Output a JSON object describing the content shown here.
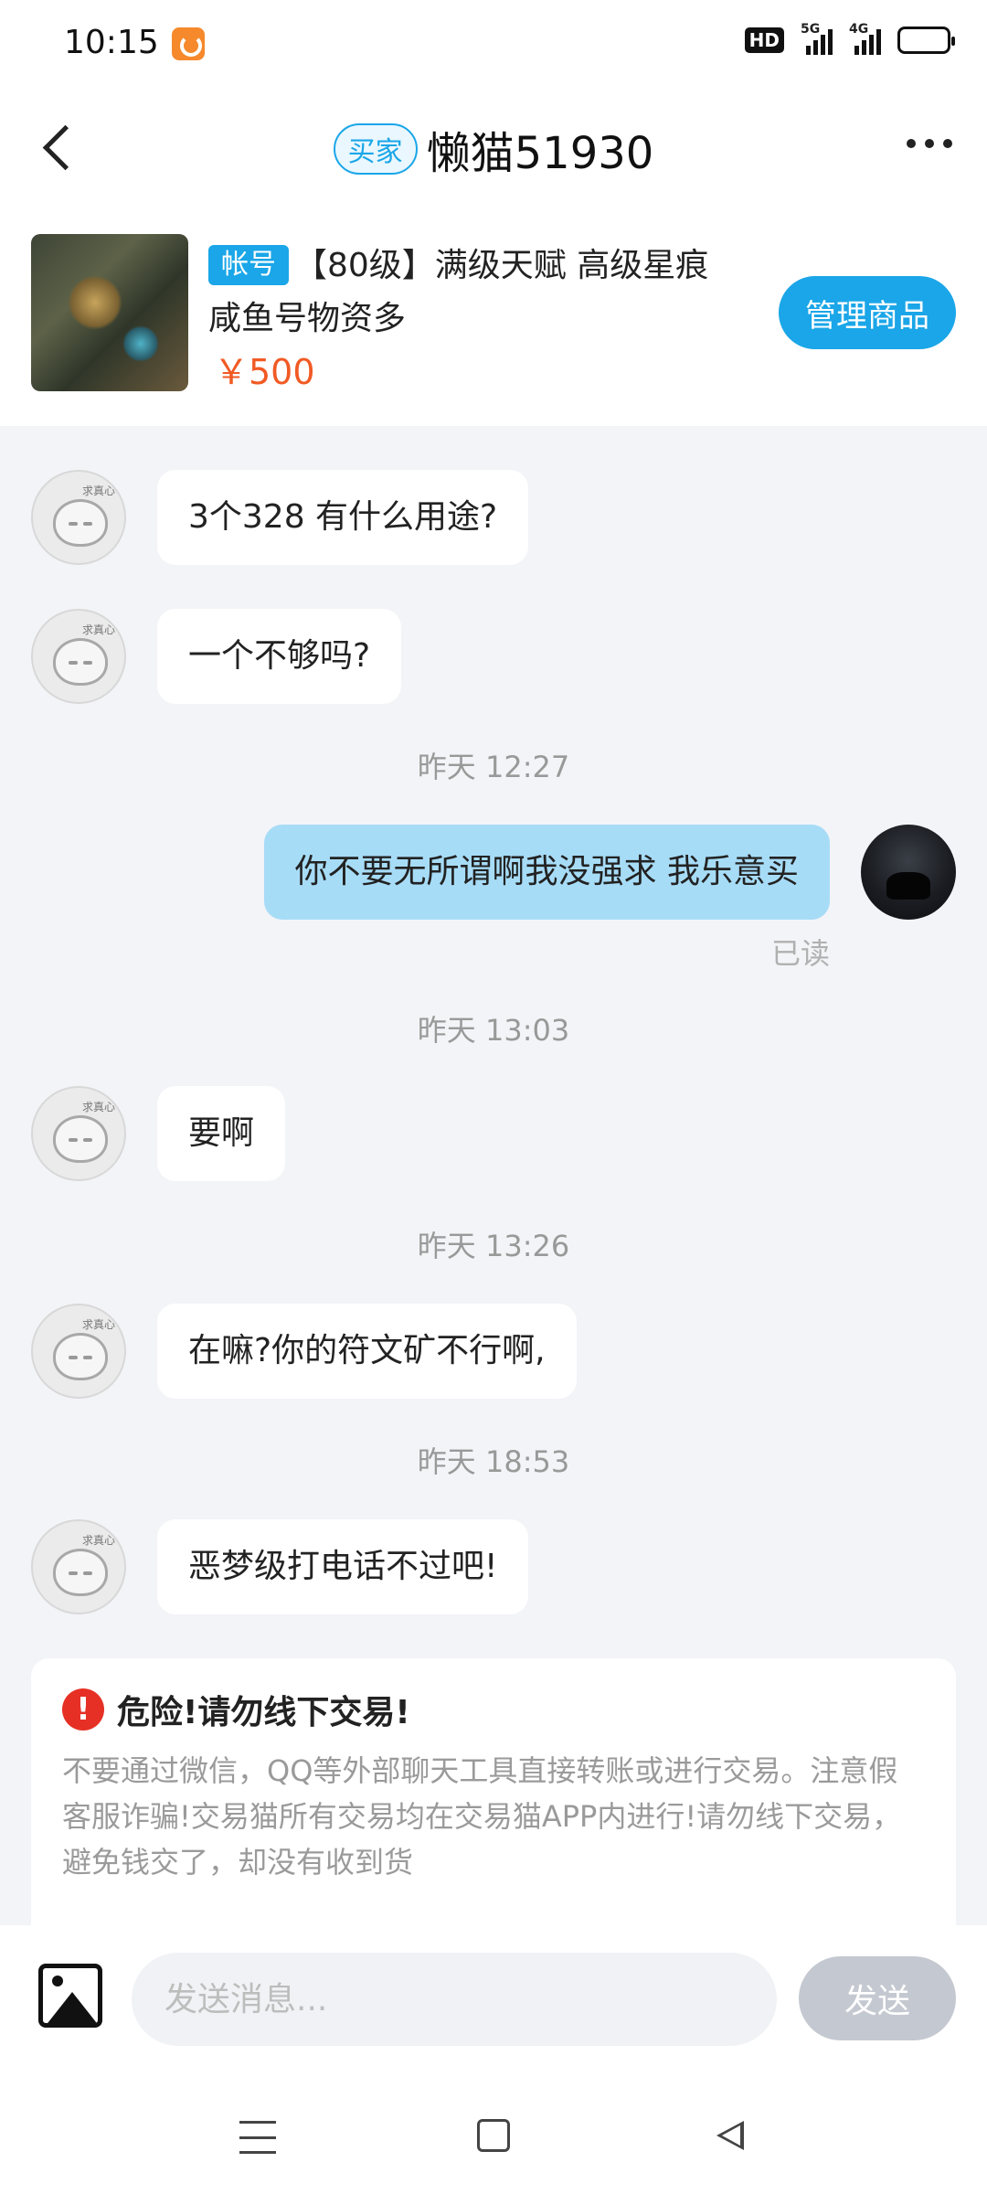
{
  "status_bar": {
    "time": "10:15",
    "hd_label": "HD",
    "net_5g": "5G",
    "net_4g": "4G",
    "app_icon": "uc-browser-icon"
  },
  "header": {
    "role_tag": "买家",
    "title": "懒猫51930"
  },
  "product": {
    "category_tag": "帐号",
    "title": "【80级】满级天赋 高级星痕咸鱼号物资多",
    "price": "￥500",
    "manage_label": "管理商品"
  },
  "chat": {
    "messages": [
      {
        "from": "other",
        "text": "3个328 有什么用途?"
      },
      {
        "from": "other",
        "text": "一个不够吗?"
      },
      {
        "type": "time",
        "text": "昨天 12:27"
      },
      {
        "from": "self",
        "text": "你不要无所谓啊我没强求 我乐意买",
        "status": "已读"
      },
      {
        "type": "time",
        "text": "昨天 13:03"
      },
      {
        "from": "other",
        "text": "要啊"
      },
      {
        "type": "time",
        "text": "昨天 13:26"
      },
      {
        "from": "other",
        "text": "在嘛?你的符文矿不行啊,"
      },
      {
        "type": "time",
        "text": "昨天 18:53"
      },
      {
        "from": "other",
        "text": "恶梦级打电话不过吧!"
      }
    ],
    "other_avatar_text": "求真心"
  },
  "warning": {
    "icon": "!",
    "title": "危险!请勿线下交易!",
    "body": "不要通过微信，QQ等外部聊天工具直接转账或进行交易。注意假客服诈骗!交易猫所有交易均在交易猫APP内进行!请勿线下交易，避免钱交了，却没有收到货"
  },
  "input_bar": {
    "placeholder": "发送消息...",
    "send_label": "发送"
  },
  "colors": {
    "accent": "#1aa6e8",
    "price": "#f15a24",
    "self_bubble": "#a7dcf7",
    "chat_bg": "#f3f4f7",
    "danger": "#e63025"
  }
}
